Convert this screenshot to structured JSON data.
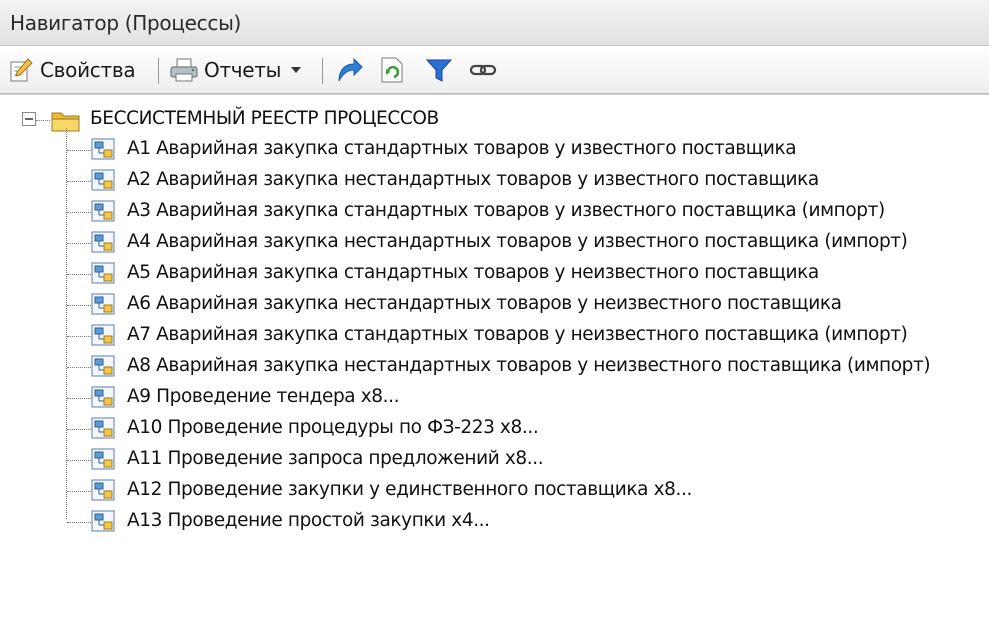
{
  "window": {
    "title": "Навигатор (Процессы)"
  },
  "toolbar": {
    "properties_label": "Свойства",
    "reports_label": "Отчеты",
    "icons": [
      "properties-icon",
      "printer-icon",
      "dropdown-arrow-icon",
      "redo-arrow-icon",
      "refresh-document-icon",
      "filter-icon",
      "link-icon"
    ]
  },
  "tree": {
    "root": {
      "label": "БЕССИСТЕМНЫЙ РЕЕСТР ПРОЦЕССОВ",
      "expanded": true
    },
    "items": [
      {
        "label": "А1 Аварийная закупка стандартных товаров у известного поставщика"
      },
      {
        "label": "А2 Аварийная закупка нестандартных товаров у известного поставщика"
      },
      {
        "label": "А3 Аварийная закупка стандартных товаров у известного поставщика (импорт)"
      },
      {
        "label": "А4 Аварийная закупка нестандартных товаров у известного поставщика (импорт)"
      },
      {
        "label": "А5 Аварийная закупка стандартных товаров у неизвестного поставщика"
      },
      {
        "label": "А6 Аварийная закупка нестандартных товаров у неизвестного поставщика"
      },
      {
        "label": "А7 Аварийная закупка стандартных товаров у неизвестного поставщика (импорт)"
      },
      {
        "label": "А8 Аварийная закупка нестандартных товаров у неизвестного поставщика (импорт)"
      },
      {
        "label": "А9 Проведение тендера x8..."
      },
      {
        "label": "А10 Проведение процедуры по ФЗ-223 x8..."
      },
      {
        "label": "А11 Проведение запроса предложений x8..."
      },
      {
        "label": "А12 Проведение закупки у единственного поставщика x8..."
      },
      {
        "label": "А13 Проведение простой закупки x4..."
      }
    ]
  },
  "colors": {
    "folder": "#f2c94c",
    "process_icon": "#5c9bd6",
    "filter": "#2a6fd6"
  }
}
